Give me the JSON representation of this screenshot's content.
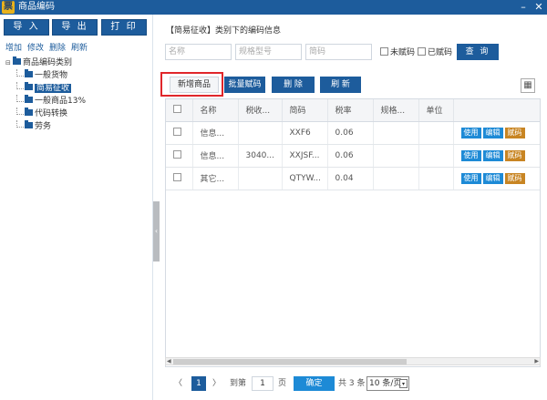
{
  "window": {
    "title": "商品编码",
    "logo_text": "票",
    "minimize": "–",
    "close": "✕"
  },
  "left": {
    "buttons": [
      "导 入",
      "导 出",
      "打 印"
    ],
    "actions": [
      "增加",
      "修改",
      "删除",
      "刷新"
    ],
    "tree": {
      "root_label": "商品编码类别",
      "toggle": "⊟",
      "children": [
        "一般货物",
        "简易征收",
        "一般商品13%",
        "代码转换",
        "劳务"
      ],
      "selected_index": 1
    },
    "splitter_arrow": "‹"
  },
  "right": {
    "section_title": "【简易征收】类别下的编码信息",
    "search": {
      "name_placeholder": "名称",
      "spec_placeholder": "规格型号",
      "code_placeholder": "简码",
      "uncoded_label": "未赋码",
      "coded_label": "已赋码",
      "query_label": "查 询"
    },
    "toolbar": {
      "new_label": "新增商品",
      "batch_label": "批量赋码",
      "delete_label": "删 除",
      "refresh_label": "刷 新",
      "grid_icon": "▦"
    },
    "table": {
      "headers": [
        "",
        "名称",
        "税收...",
        "简码",
        "税率",
        "规格...",
        "单位",
        ""
      ],
      "rows": [
        {
          "name": "信息...",
          "tax": "",
          "code": "XXF6",
          "rate": "0.06",
          "spec": "",
          "unit": ""
        },
        {
          "name": "信息...",
          "tax": "3040...",
          "code": "XXJSF...",
          "rate": "0.06",
          "spec": "",
          "unit": ""
        },
        {
          "name": "其它...",
          "tax": "",
          "code": "QTYW...",
          "rate": "0.04",
          "spec": "",
          "unit": ""
        }
      ],
      "row_actions": [
        "使用",
        "编辑",
        "赋码"
      ]
    },
    "pager": {
      "prev": "〈",
      "current": "1",
      "next": "〉",
      "goto_label": "到第",
      "goto_value": "1",
      "page_label": "页",
      "confirm_label": "确定",
      "total_label": "共 3 条",
      "page_size": "10 条/页",
      "dropdown": "▾"
    }
  }
}
